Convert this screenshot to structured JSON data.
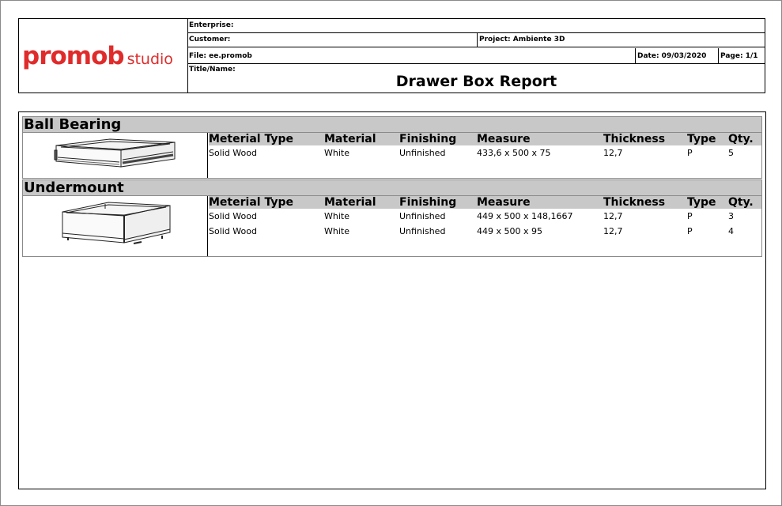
{
  "header": {
    "logo": {
      "brand": "promob",
      "suffix": "studio",
      "color": "#e02b2b"
    },
    "enterprise_label": "Enterprise:",
    "enterprise_value": "",
    "customer_label": "Customer:",
    "customer_value": "",
    "project_label": "Project: Ambiente 3D",
    "file_label": "File: ee.promob",
    "date_label": "Date: 09/03/2020",
    "page_label": "Page: 1/1",
    "title_name_label": "Title/Name:",
    "report_title": "Drawer Box Report"
  },
  "columns": [
    "Meterial Type",
    "Material",
    "Finishing",
    "Measure",
    "Thickness",
    "Type",
    "Qty."
  ],
  "groups": [
    {
      "name": "Ball Bearing",
      "icon": "drawer-box-ball-bearing",
      "rows": [
        [
          "Solid Wood",
          "White",
          "Unfinished",
          "433,6 x 500 x 75",
          "12,7",
          "P",
          "5"
        ]
      ]
    },
    {
      "name": "Undermount",
      "icon": "drawer-box-undermount",
      "rows": [
        [
          "Solid Wood",
          "White",
          "Unfinished",
          "449 x 500 x 148,1667",
          "12,7",
          "P",
          "3"
        ],
        [
          "Solid Wood",
          "White",
          "Unfinished",
          "449 x 500 x 95",
          "12,7",
          "P",
          "4"
        ]
      ]
    }
  ],
  "colors": {
    "header_bg": "#c8c8c8",
    "border": "#000000"
  }
}
